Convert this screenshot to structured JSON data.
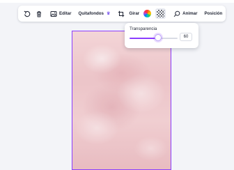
{
  "toolbar": {
    "edit_label": "Editar",
    "remove_bg_label": "Quitafondos",
    "rotate_label": "Girar",
    "animate_label": "Animar",
    "position_label": "Posición"
  },
  "transparency": {
    "title": "Transparencia",
    "value": "60",
    "level": 0.6
  },
  "colors": {
    "accent": "#8b3dff",
    "image_tint": "#f0c8cc"
  },
  "icons": [
    "undo-icon",
    "trash-icon",
    "edit-image-icon",
    "crown-icon",
    "crop-icon",
    "color-wheel-icon",
    "transparency-icon",
    "animate-icon"
  ]
}
